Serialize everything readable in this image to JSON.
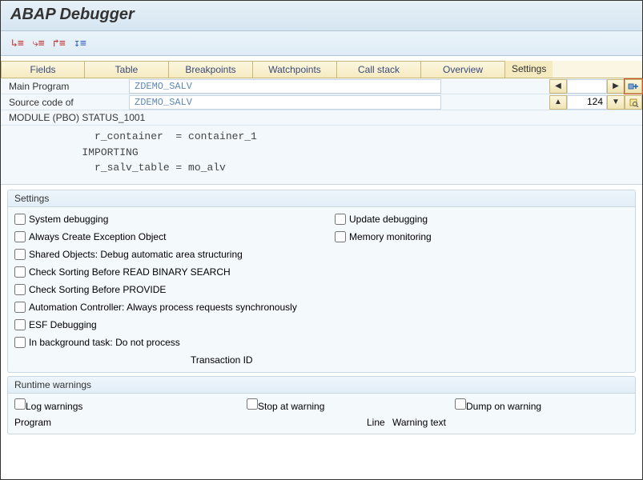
{
  "title": "ABAP Debugger",
  "tabs": {
    "fields": "Fields",
    "table": "Table",
    "breakpoints": "Breakpoints",
    "watchpoints": "Watchpoints",
    "callstack": "Call stack",
    "overview": "Overview",
    "settings": "Settings"
  },
  "main": {
    "program_label": "Main Program",
    "program_value": "ZDEMO_SALV",
    "source_label": "Source code of",
    "source_value": "ZDEMO_SALV",
    "line_number": "124",
    "module_line": "MODULE (PBO) STATUS_1001",
    "code": "               r_container  = container_1\n             IMPORTING\n               r_salv_table = mo_alv"
  },
  "settings": {
    "header": "Settings",
    "system_debugging": "System debugging",
    "update_debugging": "Update debugging",
    "always_create_exception": "Always Create Exception Object",
    "memory_monitoring": "Memory monitoring",
    "shared_objects": "Shared Objects: Debug automatic area structuring",
    "check_read_binary": "Check Sorting Before READ BINARY SEARCH",
    "check_provide": "Check Sorting Before PROVIDE",
    "automation_controller": "Automation Controller: Always process requests synchronously",
    "esf_debugging": "ESF Debugging",
    "background_task": "In background task: Do not process",
    "transaction_id": "Transaction ID"
  },
  "runtime": {
    "header": "Runtime warnings",
    "log_warnings": "Log warnings",
    "stop_at_warning": "Stop at warning",
    "dump_on_warning": "Dump on warning",
    "program": "Program",
    "line": "Line",
    "warning_text": "Warning text"
  }
}
